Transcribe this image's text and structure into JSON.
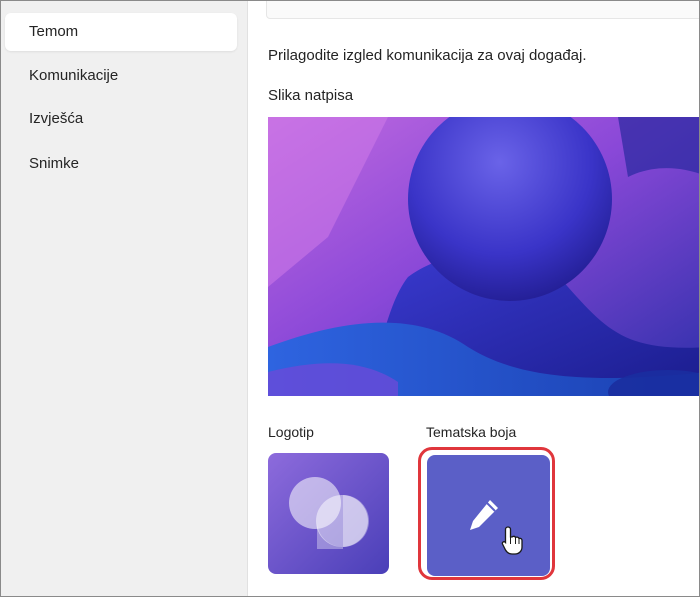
{
  "sidebar": {
    "items": [
      {
        "label": "Temom",
        "selected": true
      },
      {
        "label": "Komunikacije",
        "selected": false
      },
      {
        "label": "Izvješća",
        "selected": false
      },
      {
        "label": "Snimke",
        "selected": false
      }
    ]
  },
  "main": {
    "description": "Prilagodite izgled komunikacija za ovaj događaj.",
    "banner_label": "Slika natpisa",
    "logo_label": "Logotip",
    "theme_label": "Tematska boja"
  },
  "icons": {
    "theme_edit": "pencil-icon",
    "cursor": "hand-pointer-icon",
    "logo": "teams-chat-bubbles-logo"
  },
  "colors": {
    "theme_color": "#5b5fc7",
    "highlight_outline": "#e0363c",
    "sidebar_background": "#f0f0f0"
  }
}
